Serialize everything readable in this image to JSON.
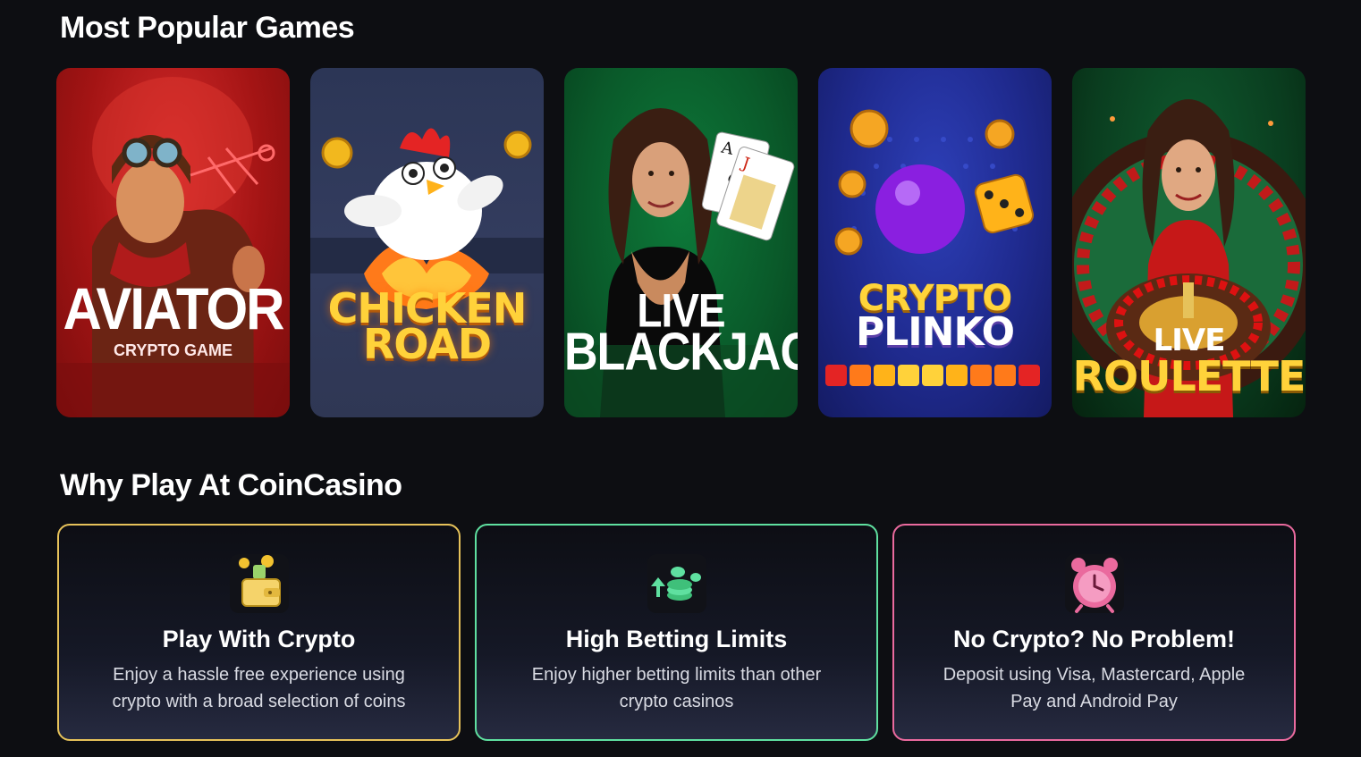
{
  "sections": {
    "popular_title": "Most Popular Games",
    "why_title": "Why Play At CoinCasino"
  },
  "games": [
    {
      "id": "aviator",
      "title_line1": "AVIATOR",
      "subtitle": "CRYPTO GAME",
      "accent": "#c81d1d"
    },
    {
      "id": "chicken-road",
      "title_line1": "CHICKEN",
      "title_line2": "ROAD",
      "accent": "#ffd23a"
    },
    {
      "id": "live-blackjack",
      "title_line1": "LIVE",
      "title_line2": "BLACKJACK",
      "accent": "#0d7a3a"
    },
    {
      "id": "crypto-plinko",
      "title_line1": "CRYPTO",
      "title_line2": "PLINKO",
      "accent": "#2d3fb8"
    },
    {
      "id": "live-roulette",
      "title_line1": "LIVE",
      "title_line2": "ROULETTE",
      "accent": "#ffd23a"
    }
  ],
  "features": [
    {
      "title": "Play With Crypto",
      "text": "Enjoy a hassle free experience using crypto with a broad selection of coins",
      "icon": "wallet-coins-icon",
      "border": "#e6c25a"
    },
    {
      "title": "High Betting Limits",
      "text": "Enjoy higher betting limits than other crypto casinos",
      "icon": "coin-stack-arrow-icon",
      "border": "#5fe0a0"
    },
    {
      "title": "No Crypto? No Problem!",
      "text": "Deposit using Visa, Mastercard, Apple Pay and Android Pay",
      "icon": "alarm-clock-icon",
      "border": "#ea6a9e"
    }
  ]
}
